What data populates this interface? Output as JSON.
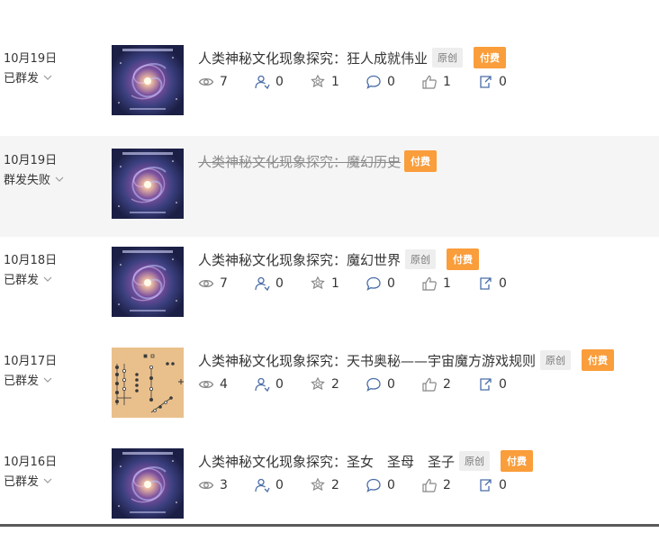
{
  "rows": [
    {
      "date": "10月19日",
      "status": "已群发",
      "title": "人类神秘文化现象探究：狂人成就伟业",
      "original_tag": "原创",
      "paid_tag": "付费",
      "stats": {
        "reads": "7",
        "shares": "0",
        "favorites": "1",
        "comments": "0",
        "likes": "1",
        "reprints": "0"
      }
    },
    {
      "date": "10月19日",
      "status": "群发失败",
      "title": "人类神秘文化现象探究：魔幻历史",
      "paid_tag": "付费"
    },
    {
      "date": "10月18日",
      "status": "已群发",
      "title": "人类神秘文化现象探究：魔幻世界",
      "original_tag": "原创",
      "paid_tag": "付费",
      "stats": {
        "reads": "7",
        "shares": "0",
        "favorites": "1",
        "comments": "0",
        "likes": "1",
        "reprints": "0"
      }
    },
    {
      "date": "10月17日",
      "status": "已群发",
      "title": "人类神秘文化现象探究：天书奥秘——宇宙魔方游戏规则",
      "original_tag": "原创",
      "paid_tag": "付费",
      "stats": {
        "reads": "4",
        "shares": "0",
        "favorites": "2",
        "comments": "0",
        "likes": "2",
        "reprints": "0"
      }
    },
    {
      "date": "10月16日",
      "status": "已群发",
      "title": "人类神秘文化现象探究：圣女　圣母　圣子",
      "original_tag": "原创",
      "paid_tag": "付费",
      "stats": {
        "reads": "3",
        "shares": "0",
        "favorites": "2",
        "comments": "0",
        "likes": "2",
        "reprints": "0"
      }
    }
  ],
  "icons": {
    "reads": "eye-icon",
    "shares": "user-share-icon",
    "favorites": "star-icon",
    "comments": "comment-icon",
    "likes": "thumbs-up-icon",
    "reprints": "reprint-icon",
    "status_toggle": "chevron-down-icon"
  },
  "colors": {
    "paid_tag": "#fa9d3b",
    "failed_row_bg": "#f5f5f5",
    "icon_blue": "#4a6da7"
  }
}
